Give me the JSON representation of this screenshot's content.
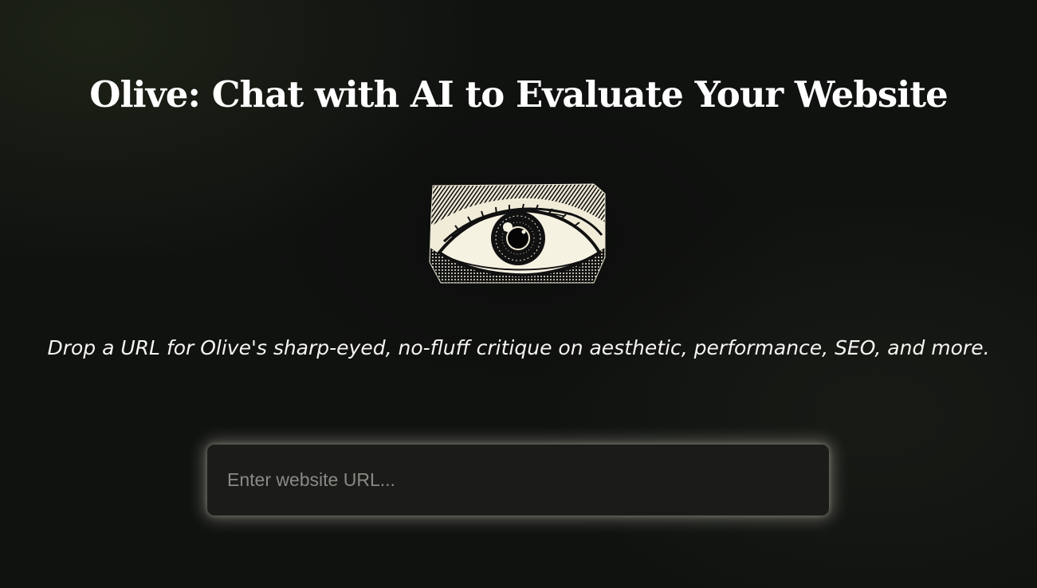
{
  "page": {
    "title": "Olive: Chat with AI to Evaluate Your Website",
    "subtitle": "Drop a URL for Olive's sharp-eyed, no-fluff critique on aesthetic, performance, SEO, and more."
  },
  "hero": {
    "icon": "eye-icon"
  },
  "url_input": {
    "placeholder": "Enter website URL...",
    "value": ""
  },
  "colors": {
    "background": "#101210",
    "text": "#ffffff",
    "input_background": "#1b1c19",
    "input_glow": "#d2cebe",
    "placeholder": "#8a8a84",
    "eye_paper": "#f1ecd8"
  }
}
